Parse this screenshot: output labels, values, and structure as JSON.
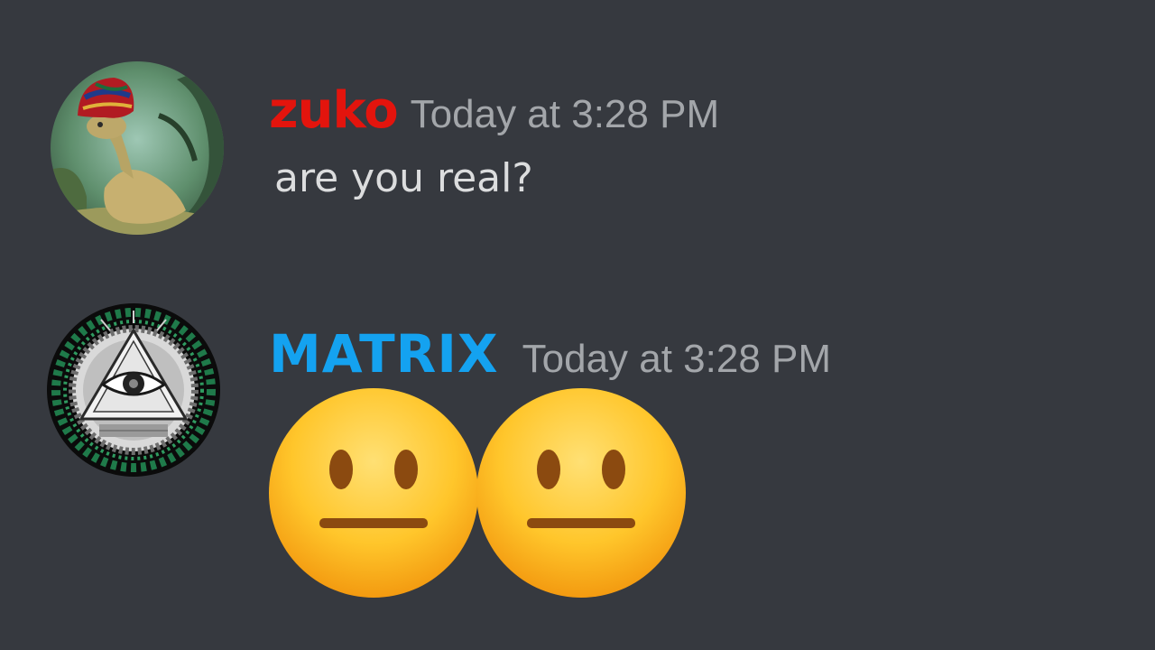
{
  "messages": [
    {
      "username": "zuko",
      "username_color": "#e3140d",
      "timestamp": "Today at 3:28 PM",
      "text": "are you real?",
      "avatar_icon": "turban-creature-avatar"
    },
    {
      "username": "MATRIX",
      "username_color": "#14a2f0",
      "timestamp": "Today at 3:28 PM",
      "emojis": [
        "neutral-face-emoji",
        "neutral-face-emoji"
      ],
      "avatar_icon": "all-seeing-eye-pyramid-avatar"
    }
  ],
  "theme": {
    "background": "#36393f",
    "timestamp_color": "#a3a6aa",
    "text_color": "#dcddde"
  }
}
